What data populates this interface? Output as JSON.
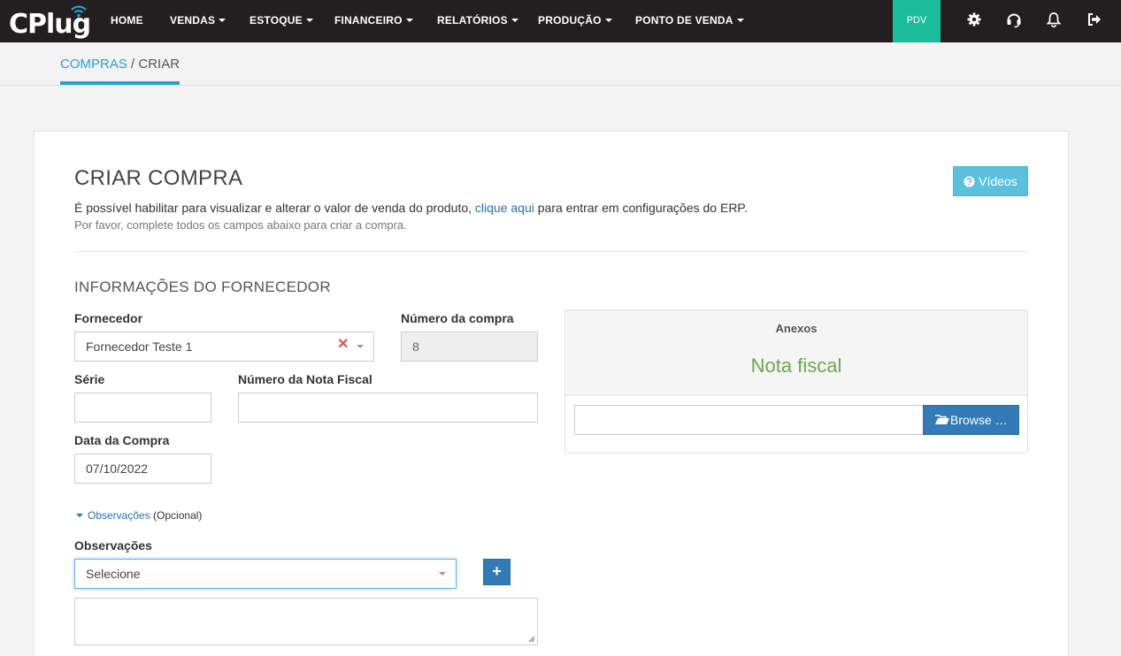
{
  "brand": {
    "logo_text": "CPlug"
  },
  "nav": {
    "items": [
      {
        "label": "HOME",
        "dropdown": false
      },
      {
        "label": "VENDAS",
        "dropdown": true
      },
      {
        "label": "ESTOQUE",
        "dropdown": true
      },
      {
        "label": "FINANCEIRO",
        "dropdown": true
      },
      {
        "label": "RELATÓRIOS",
        "dropdown": true
      },
      {
        "label": "PRODUÇÃO",
        "dropdown": true
      },
      {
        "label": "PONTO DE VENDA",
        "dropdown": true
      }
    ],
    "pdv_label": "PDV",
    "icons": [
      "gear-icon",
      "headset-icon",
      "bell-icon",
      "logout-icon"
    ]
  },
  "breadcrumb": {
    "section": "COMPRAS",
    "separator": " / ",
    "current": "CRIAR"
  },
  "page": {
    "title": "CRIAR COMPRA",
    "info_before": "É possível habilitar para visualizar e alterar o valor de venda do produto, ",
    "info_link": "clique aqui",
    "info_after": " para entrar em configurações do ERP.",
    "subinfo": "Por favor, complete todos os campos abaixo para criar a compra.",
    "videos_label": "Vídeos"
  },
  "form": {
    "section_title": "INFORMAÇÕES DO FORNECEDOR",
    "fornecedor_label": "Fornecedor",
    "fornecedor_value": "Fornecedor Teste 1",
    "numero_compra_label": "Número da compra",
    "numero_compra_value": "8",
    "serie_label": "Série",
    "serie_value": "",
    "nota_fiscal_label": "Número da Nota Fiscal",
    "nota_fiscal_value": "",
    "data_label": "Data da Compra",
    "data_value": "07/10/2022",
    "obs_toggle": "Observações",
    "obs_optional": "(Opcional)",
    "obs_label": "Observações",
    "obs_select_value": "Selecione",
    "obs_text": ""
  },
  "anexos": {
    "title": "Anexos",
    "subtitle": "Nota fiscal",
    "browse_label": "Browse …"
  },
  "colors": {
    "topbar": "#231f20",
    "accent": "#2a9fd6",
    "pdv": "#1abc9c",
    "primary": "#337ab7",
    "info": "#5bc0de",
    "success_text": "#6aa84f"
  }
}
